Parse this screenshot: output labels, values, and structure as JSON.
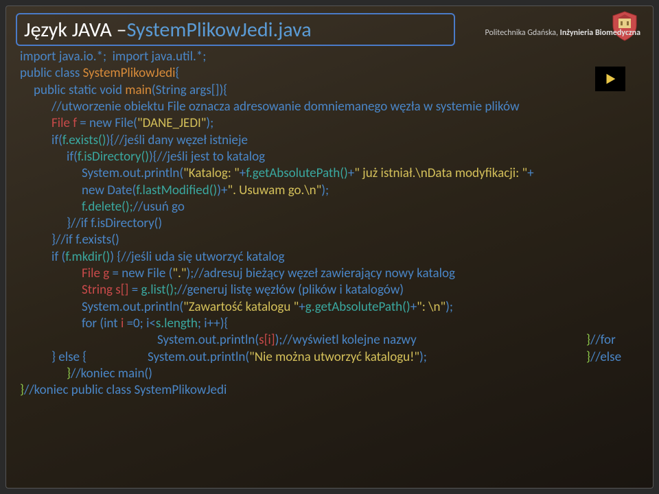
{
  "title": {
    "prefix": "Język JAVA – ",
    "filename": "SystemPlikowJedi.java"
  },
  "header": {
    "institution": "Politechnika Gdańska, ",
    "dept": "Inżynieria Biomedyczna"
  },
  "code": {
    "l01a": "import java.io.*;  import java.util.*;",
    "l02a": "public class ",
    "l02b": "SystemPlikowJedi",
    "l02c": "{",
    "l03a": "public static void ",
    "l03b": "main",
    "l03c": "(String args[]){",
    "l04": "//utworzenie obiektu File oznacza adresowanie domniemanego węzła w systemie plików",
    "l05a": "File f ",
    "l05b": "= new File(",
    "l05c": "\"DANE_JEDI\"",
    "l05d": ");",
    "l06a": "if(",
    "l06b": "f.exists()",
    "l06c": "){",
    "l06d": "//jeśli dany węzeł istnieje",
    "l07a": "if(",
    "l07b": "f.isDirectory()",
    "l07c": "){",
    "l07d": "//jeśli jest to katalog",
    "l08a": "System.out.println(",
    "l08b": "\"Katalog: \"",
    "l08c": "+",
    "l08d": "f.getAbsolutePath()",
    "l08e": "+",
    "l08f": "\" już istniał.\\nData modyfikacji: \"",
    "l08g": "+",
    "l09a": "new Date(",
    "l09b": "f.lastModified()",
    "l09c": ")+",
    "l09d": "\". Usuwam go.\\n\"",
    "l09e": ");",
    "l10a": "f.delete();",
    "l10b": "//usuń go",
    "l11a": "}",
    "l11b": "//if f.isDirectory()",
    "l12a": "}",
    "l12b": "//if f.exists()",
    "l13a": "if (",
    "l13b": "f.mkdir()",
    "l13c": ") {",
    "l13d": "//jeśli uda się utworzyć katalog",
    "l14a": "File g ",
    "l14b": "= new File (",
    "l14c": "\".\"",
    "l14d": ");",
    "l14e": "//adresuj bieżący węzeł zawierający nowy katalog",
    "l15a": "String s[] ",
    "l15b": "= ",
    "l15c": "g.list();",
    "l15d": "//generuj listę węzłów (plików i katalogów)",
    "l16a": "System.out.println(",
    "l16b": "\"Zawartość katalogu \"",
    "l16c": "+",
    "l16d": "g.getAbsolutePath()",
    "l16e": "+",
    "l16f": "\": \\n\"",
    "l16g": ");",
    "l17a": "for (int ",
    "l17b": "i ",
    "l17c": "=0; i<",
    "l17d": "s.length",
    "l17e": "; i++){",
    "l18a": "System.out.println(",
    "l18b": "s[i]",
    "l18c": ");",
    "l18d": "//wyświetl kolejne nazwy",
    "l18e": "}",
    "l18f": "//for",
    "l19a": "} else {",
    "l19b": "System.out.println(",
    "l19c": "\"Nie można utworzyć katalogu!\"",
    "l19d": ");",
    "l19e": "}",
    "l19f": "//else",
    "l20a": "}",
    "l20b": "//koniec main()",
    "l21a": "}",
    "l21b": "//koniec public class SystemPlikowJedi"
  }
}
